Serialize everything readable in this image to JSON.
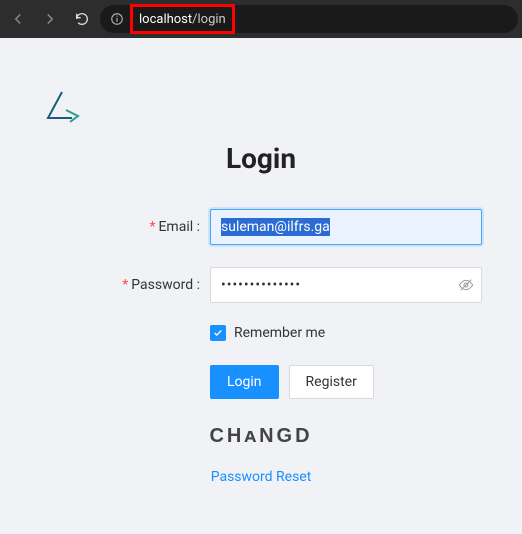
{
  "browser": {
    "url_host": "localhost",
    "url_path": "/login"
  },
  "page": {
    "title": "Login",
    "brand": "CHᴀNGD",
    "password_reset": "Password Reset"
  },
  "form": {
    "email_label": "Email :",
    "email_value": "suleman@ilfrs.ga",
    "password_label": "Password :",
    "password_value": "••••••••••••••",
    "remember_label": "Remember me",
    "remember_checked": true,
    "login_button": "Login",
    "register_button": "Register"
  }
}
